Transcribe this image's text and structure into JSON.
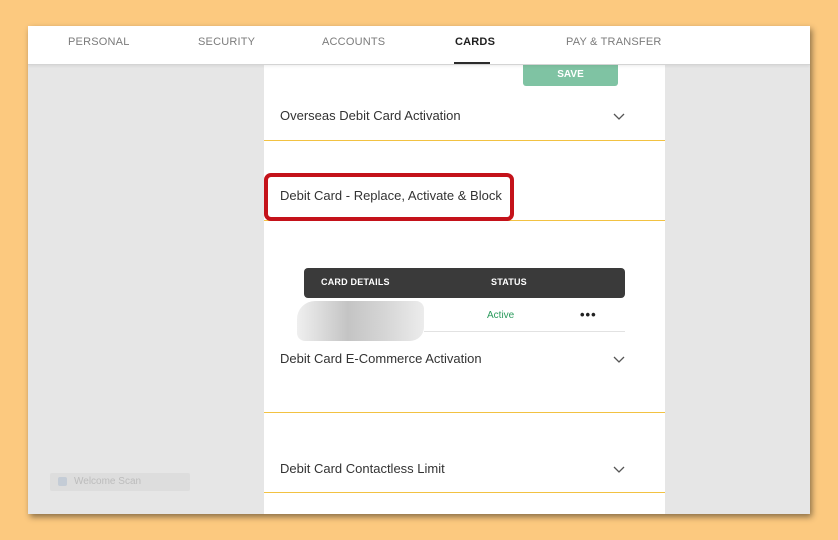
{
  "nav": {
    "tabs": [
      {
        "label": "PERSONAL"
      },
      {
        "label": "SECURITY"
      },
      {
        "label": "ACCOUNTS"
      },
      {
        "label": "CARDS"
      },
      {
        "label": "PAY & TRANSFER"
      }
    ],
    "active_tab": "CARDS"
  },
  "panel": {
    "save_label": "SAVE",
    "sections": [
      {
        "label": "Overseas Debit Card Activation",
        "icon": "chevron-down-icon"
      },
      {
        "label": "Debit Card - Replace, Activate & Block"
      },
      {
        "label": "Debit Card E-Commerce Activation",
        "icon": "chevron-down-icon"
      },
      {
        "label": "Debit Card Contactless Limit",
        "icon": "chevron-down-icon"
      }
    ],
    "card_table": {
      "headers": [
        "CARD DETAILS",
        "STATUS"
      ],
      "rows": [
        {
          "card": "",
          "status": "Active",
          "menu": "•••"
        }
      ]
    }
  },
  "colors": {
    "page_bg": "#fcc97f",
    "save_button": "#7fc3a3",
    "section_divider": "#f2c242",
    "highlight": "#c4121a",
    "status_active": "#2a9a5c",
    "table_header": "#3a3a3a"
  },
  "overlay_chip": {
    "text": "Welcome Scan"
  }
}
